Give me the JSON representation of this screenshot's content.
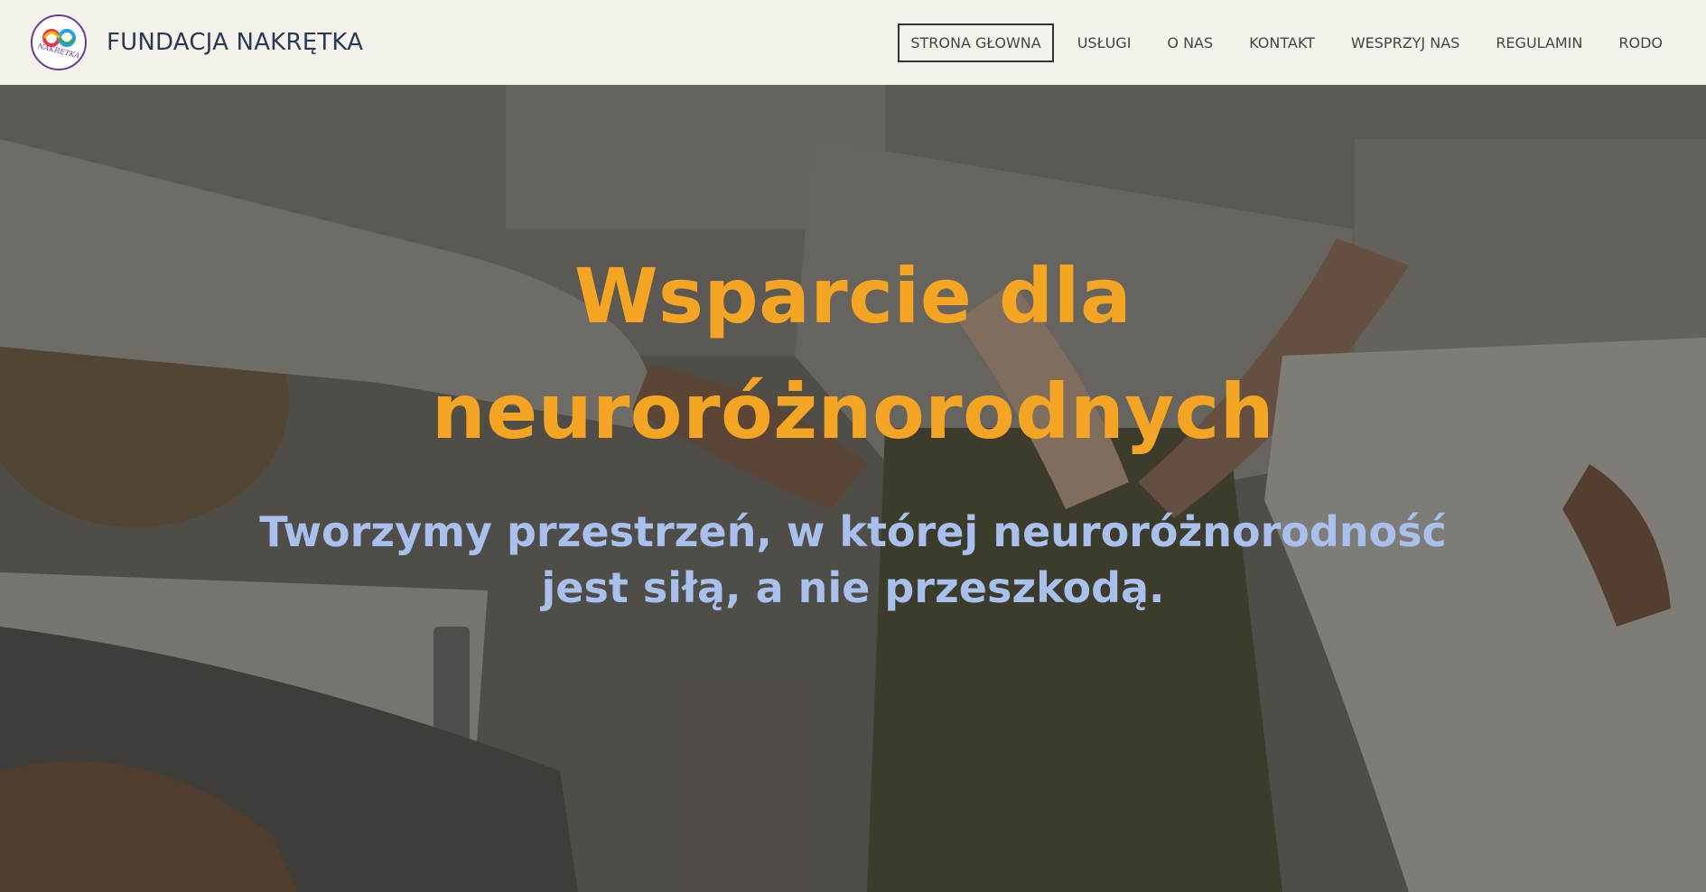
{
  "header": {
    "brand": "FUNDACJA NAKRĘTKA",
    "logo_text": "NAKRĘTKA",
    "logo_icon": "infinity-logo-icon"
  },
  "nav": {
    "items": [
      {
        "label": "STRONA GŁOWNA",
        "active": true
      },
      {
        "label": "USŁUGI",
        "active": false
      },
      {
        "label": "O NAS",
        "active": false
      },
      {
        "label": "KONTAKT",
        "active": false
      },
      {
        "label": "WESPRZYJ NAS",
        "active": false
      },
      {
        "label": "REGULAMIN",
        "active": false
      },
      {
        "label": "RODO",
        "active": false
      }
    ]
  },
  "hero": {
    "title_line1": "Wsparcie dla",
    "title_line2": "neuroróżnorodnych",
    "subtitle_line1": "Tworzymy przestrzeń, w której neuroróżnorodność",
    "subtitle_line2": "jest siłą, a nie przeszkodą."
  },
  "colors": {
    "header_bg": "#f5f2ec",
    "brand_text": "#2a3a55",
    "title": "#f5a524",
    "subtitle": "#a8c0ec"
  }
}
